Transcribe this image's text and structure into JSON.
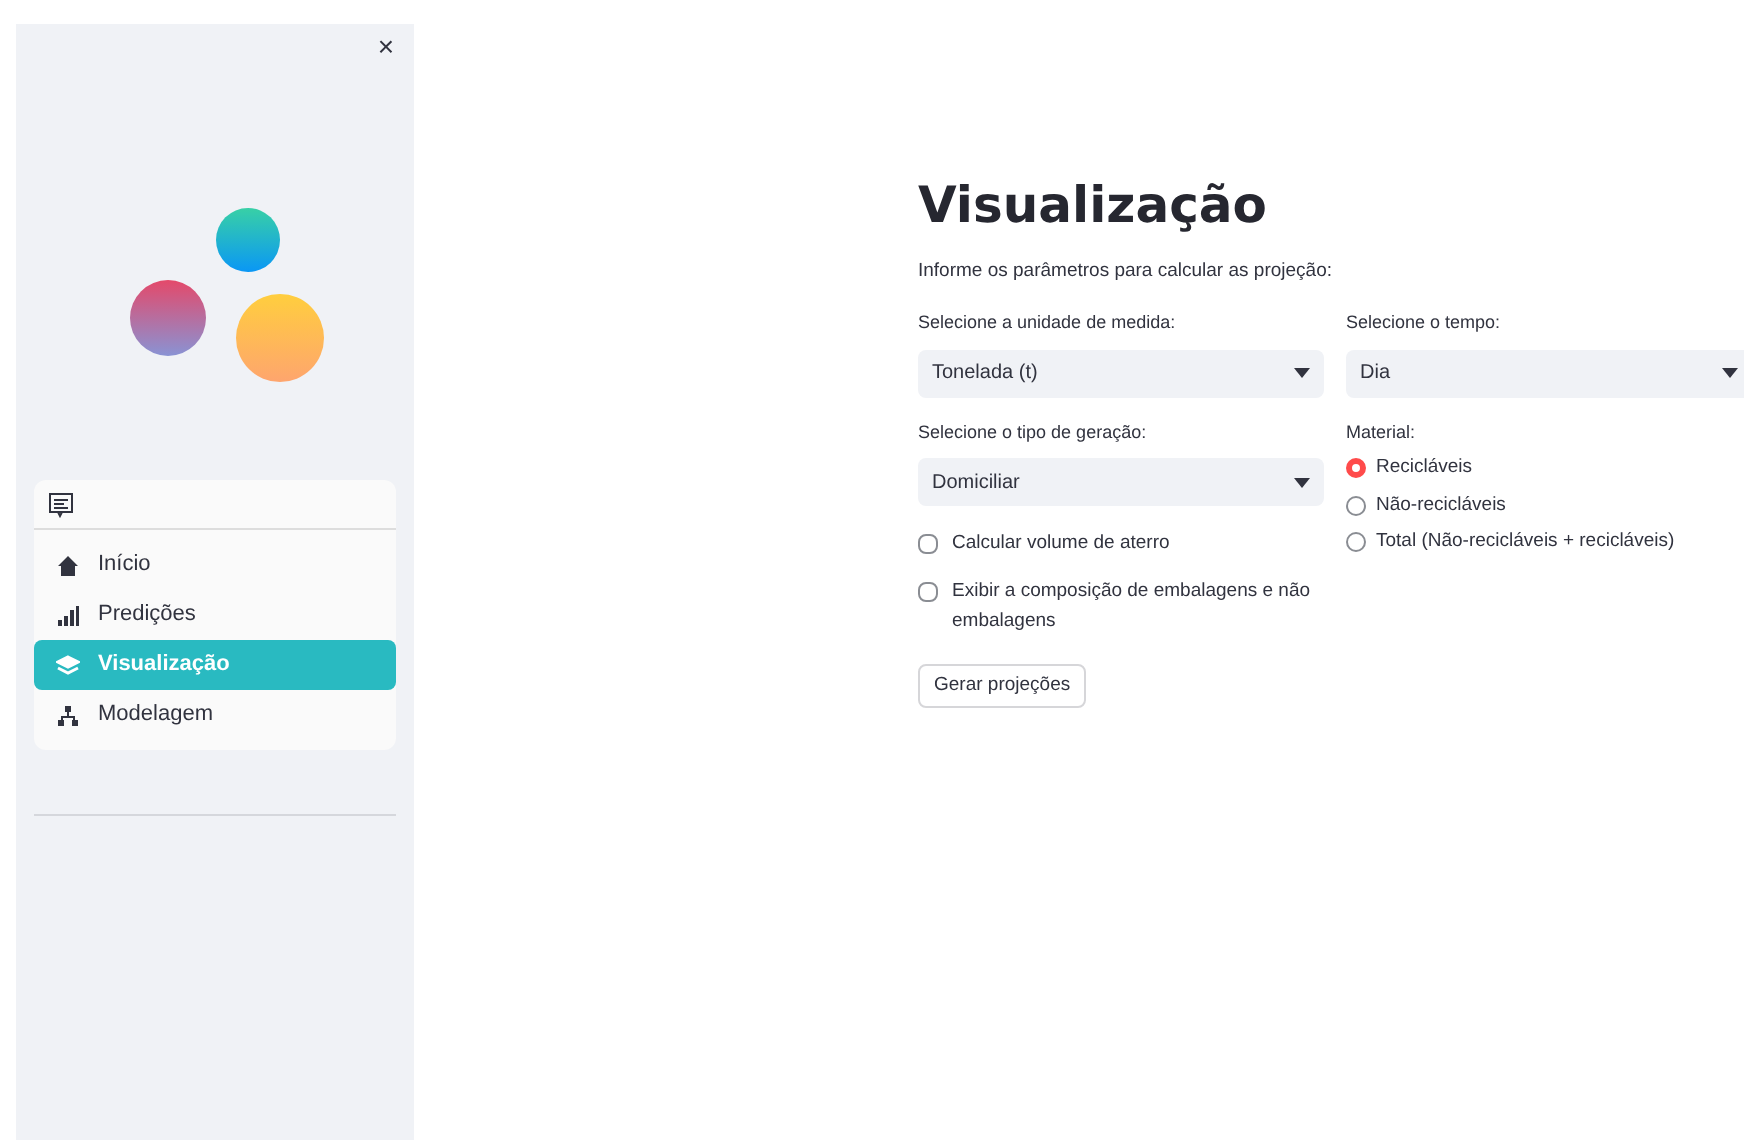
{
  "sidebar": {
    "close": "×",
    "menu": [
      {
        "label": "Início",
        "selected": false
      },
      {
        "label": "Predições",
        "selected": false
      },
      {
        "label": "Visualização",
        "selected": true
      },
      {
        "label": "Modelagem",
        "selected": false
      }
    ]
  },
  "main": {
    "title": "Visualização",
    "intro": "Informe os parâmetros para calcular as projeção:",
    "unit": {
      "label": "Selecione a unidade de medida:",
      "value": "Tonelada (t)"
    },
    "time": {
      "label": "Selecione o tempo:",
      "value": "Dia"
    },
    "generation": {
      "label": "Selecione o tipo de geração:",
      "value": "Domiciliar"
    },
    "checkboxes": [
      {
        "label": "Calcular volume de aterro",
        "checked": false
      },
      {
        "label": "Exibir a composição de embalagens e não embalagens",
        "checked": false
      }
    ],
    "button": "Gerar projeções",
    "material": {
      "label": "Material:",
      "options": [
        {
          "label": "Recicláveis",
          "selected": true
        },
        {
          "label": "Não-recicláveis",
          "selected": false
        },
        {
          "label": "Total (Não-recicláveis + recicláveis)",
          "selected": false
        }
      ]
    }
  }
}
